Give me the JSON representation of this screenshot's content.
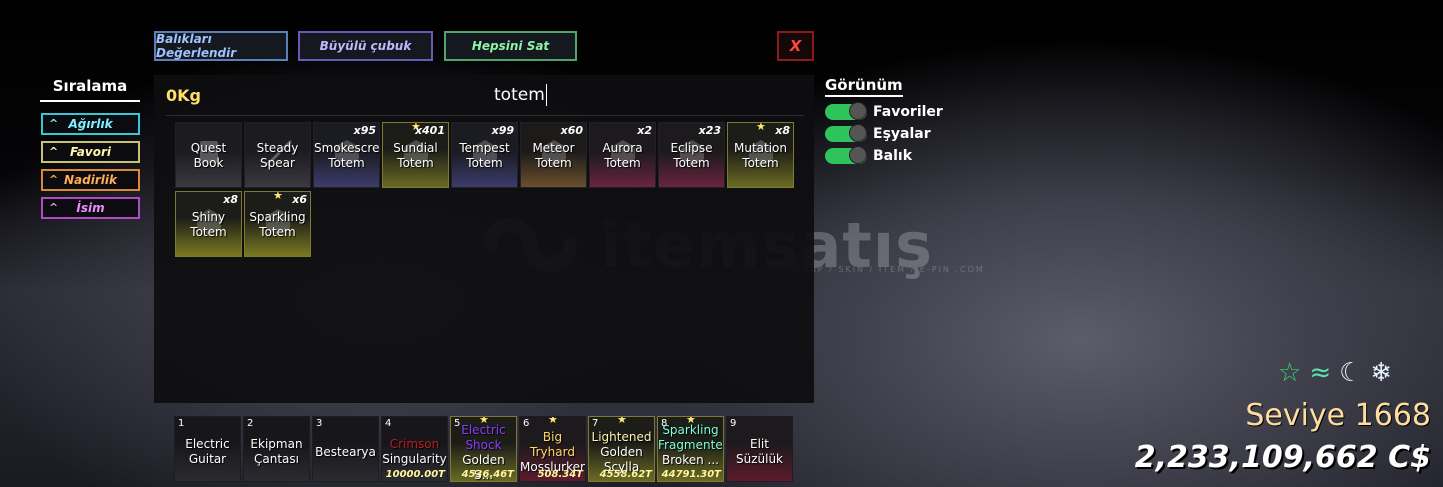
{
  "top_buttons": {
    "rate_fish": "Balıkları Değerlendir",
    "magic_rod": "Büyülü çubuk",
    "sell_all": "Hepsini Sat",
    "close": "X"
  },
  "inventory": {
    "weight": "0Kg",
    "search_value": "totem",
    "items": [
      {
        "name": "Quest Book",
        "qty": "",
        "star": false,
        "rarity": "common"
      },
      {
        "name": "Steady Spear",
        "qty": "",
        "star": false,
        "rarity": "common"
      },
      {
        "name": "Smokescreen Totem",
        "qty": "x95",
        "star": false,
        "rarity": "blue"
      },
      {
        "name": "Sundial Totem",
        "qty": "x401",
        "star": true,
        "rarity": "gold"
      },
      {
        "name": "Tempest Totem",
        "qty": "x99",
        "star": false,
        "rarity": "blue"
      },
      {
        "name": "Meteor Totem",
        "qty": "x60",
        "star": false,
        "rarity": "orange"
      },
      {
        "name": "Aurora Totem",
        "qty": "x2",
        "star": false,
        "rarity": "red"
      },
      {
        "name": "Eclipse Totem",
        "qty": "x23",
        "star": false,
        "rarity": "red"
      },
      {
        "name": "Mutation Totem",
        "qty": "x8",
        "star": true,
        "rarity": "gold"
      },
      {
        "name": "Shiny Totem",
        "qty": "x8",
        "star": false,
        "rarity": "yellow"
      },
      {
        "name": "Sparkling Totem",
        "qty": "x6",
        "star": true,
        "rarity": "yellow"
      }
    ]
  },
  "sort": {
    "title": "Sıralama",
    "weight": "Ağırlık",
    "favorite": "Favori",
    "rarity": "Nadirlik",
    "name": "İsim"
  },
  "view": {
    "title": "Görünüm",
    "favorites": "Favoriler",
    "items": "Eşyalar",
    "fish": "Balık"
  },
  "hotbar": [
    {
      "num": "1",
      "tag": "",
      "tag_color": "",
      "name": "Electric Guitar",
      "price": "",
      "star": false,
      "style": "plain"
    },
    {
      "num": "2",
      "tag": "",
      "tag_color": "",
      "name": "Ekipman Çantası",
      "price": "",
      "star": false,
      "style": "plain"
    },
    {
      "num": "3",
      "tag": "",
      "tag_color": "",
      "name": "Bestearya",
      "price": "",
      "star": false,
      "style": "plain"
    },
    {
      "num": "4",
      "tag": "Crimson",
      "tag_color": "#b81f1f",
      "name": "Singularity",
      "price": "10000.00T",
      "star": false,
      "style": "plain"
    },
    {
      "num": "5",
      "tag": "Electric Shock",
      "tag_color": "#8a3cff",
      "name": "Golden S...",
      "price": "4536.46T",
      "star": true,
      "style": "gold"
    },
    {
      "num": "6",
      "tag": "Big Tryhard",
      "tag_color": "#ffd76a",
      "name": "Mosslurker",
      "price": "508.34T",
      "star": true,
      "style": "red"
    },
    {
      "num": "7",
      "tag": "Lightened",
      "tag_color": "#fff3b0",
      "name": "Golden Scylla",
      "price": "4558.62T",
      "star": true,
      "style": "gold"
    },
    {
      "num": "8",
      "tag": "Sparkling Fragmented",
      "tag_color": "#7dffd9",
      "name": "Broken ...",
      "price": "44791.30T",
      "star": true,
      "style": "gold"
    },
    {
      "num": "9",
      "tag": "",
      "tag_color": "",
      "name": "Elit Süzülük",
      "price": "",
      "star": false,
      "style": "red"
    }
  ],
  "status_icons": [
    "star-icon",
    "wave-icon",
    "moon-icon",
    "snowflake-icon"
  ],
  "player": {
    "level": "Seviye 1668",
    "money": "2,233,109,662 C$"
  },
  "watermark": {
    "text": "itemsatış",
    "sub": "HESAP / SKIN / İTEM / E-PIN .COM"
  }
}
